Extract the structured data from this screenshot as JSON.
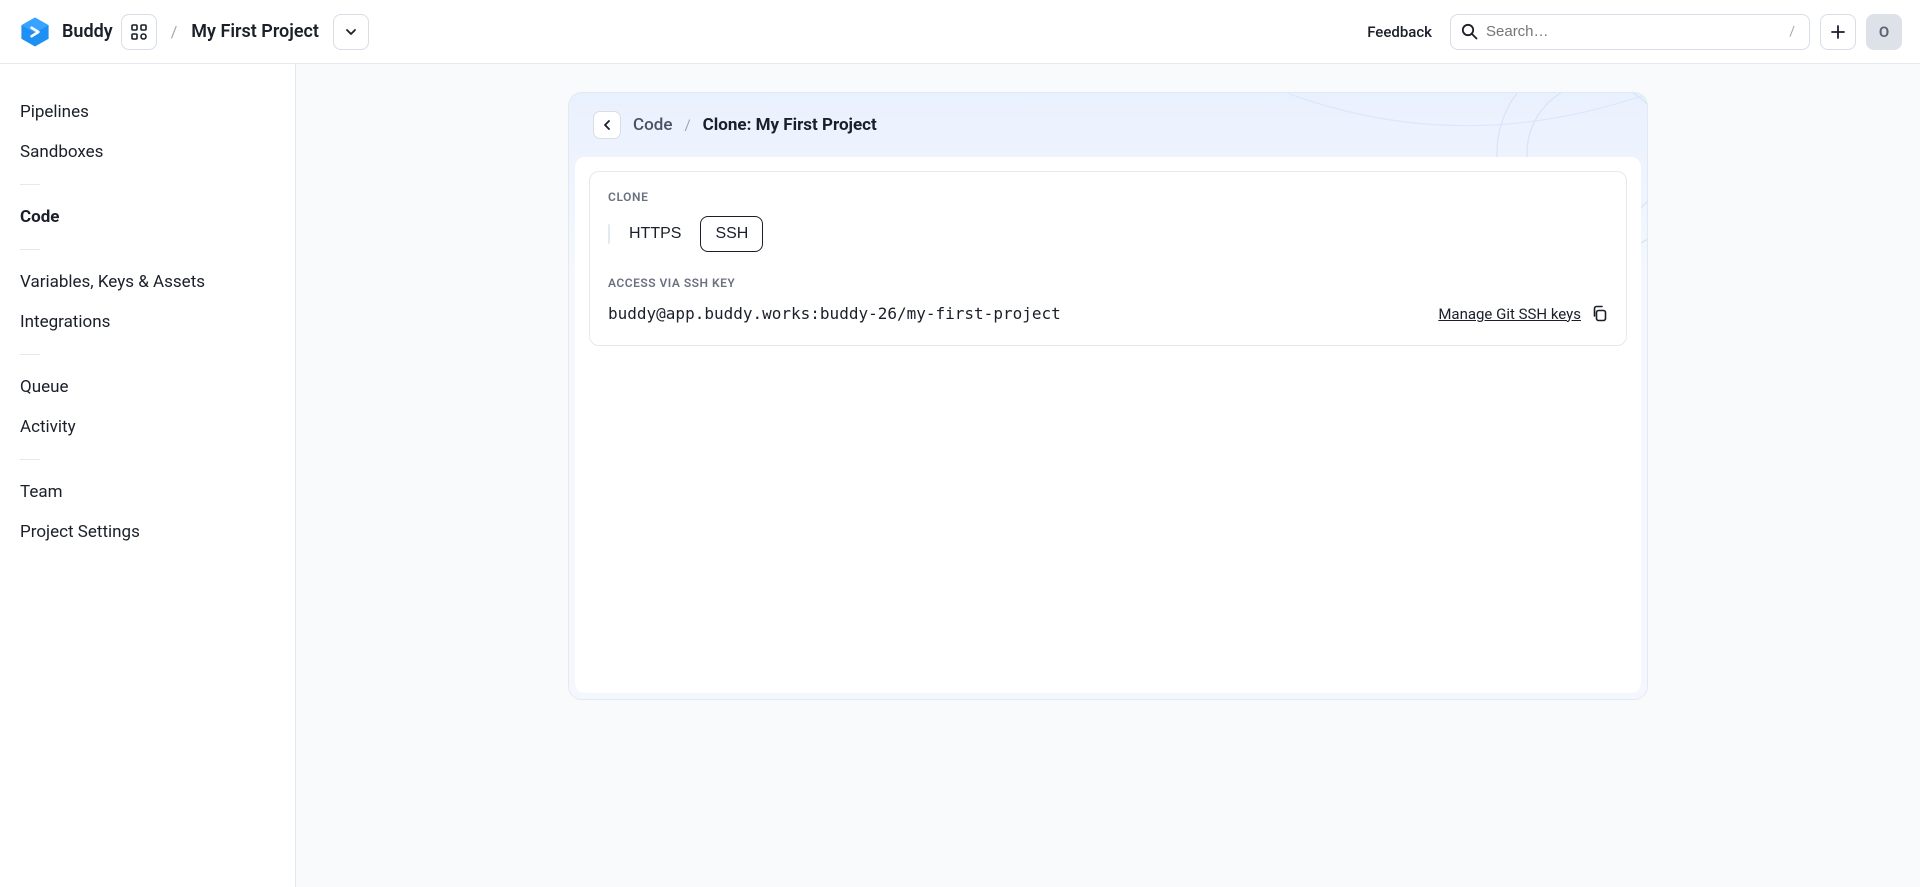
{
  "header": {
    "brand": "Buddy",
    "project": "My First Project",
    "feedback": "Feedback",
    "search_placeholder": "Search…",
    "search_shortcut": "/",
    "avatar_letter": "O"
  },
  "sidebar": {
    "items": [
      {
        "label": "Pipelines"
      },
      {
        "label": "Sandboxes"
      },
      {
        "label": "Code"
      },
      {
        "label": "Variables, Keys & Assets"
      },
      {
        "label": "Integrations"
      },
      {
        "label": "Queue"
      },
      {
        "label": "Activity"
      },
      {
        "label": "Team"
      },
      {
        "label": "Project Settings"
      }
    ],
    "active": "Code"
  },
  "breadcrumb": {
    "parent": "Code",
    "current": "Clone: My First Project"
  },
  "clone": {
    "section_label": "Clone",
    "tabs": {
      "https": "HTTPS",
      "ssh": "SSH"
    },
    "active_tab": "ssh",
    "access_label": "Access via SSH key",
    "url": "buddy@app.buddy.works:buddy-26/my-first-project",
    "manage_link": "Manage Git SSH keys"
  }
}
